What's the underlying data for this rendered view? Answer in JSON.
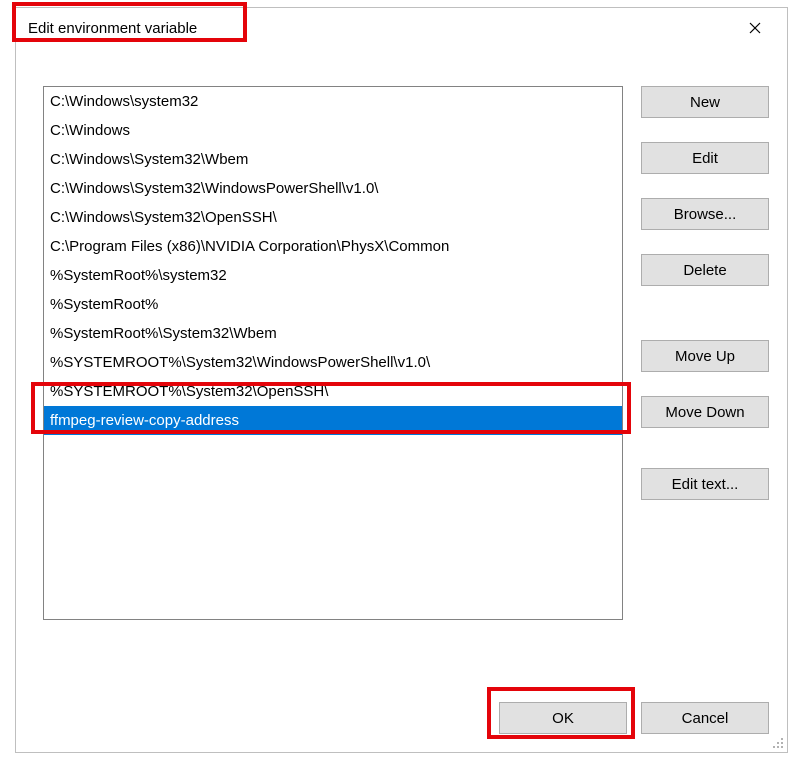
{
  "dialog": {
    "title": "Edit environment variable"
  },
  "list": {
    "items": [
      {
        "text": "C:\\Windows\\system32",
        "selected": false
      },
      {
        "text": "C:\\Windows",
        "selected": false
      },
      {
        "text": "C:\\Windows\\System32\\Wbem",
        "selected": false
      },
      {
        "text": "C:\\Windows\\System32\\WindowsPowerShell\\v1.0\\",
        "selected": false
      },
      {
        "text": "C:\\Windows\\System32\\OpenSSH\\",
        "selected": false
      },
      {
        "text": "C:\\Program Files (x86)\\NVIDIA Corporation\\PhysX\\Common",
        "selected": false
      },
      {
        "text": "%SystemRoot%\\system32",
        "selected": false
      },
      {
        "text": "%SystemRoot%",
        "selected": false
      },
      {
        "text": "%SystemRoot%\\System32\\Wbem",
        "selected": false
      },
      {
        "text": "%SYSTEMROOT%\\System32\\WindowsPowerShell\\v1.0\\",
        "selected": false
      },
      {
        "text": "%SYSTEMROOT%\\System32\\OpenSSH\\",
        "selected": false
      },
      {
        "text": "ffmpeg-review-copy-address",
        "selected": true
      }
    ]
  },
  "buttons": {
    "new": "New",
    "edit": "Edit",
    "browse": "Browse...",
    "delete": "Delete",
    "moveup": "Move Up",
    "movedown": "Move Down",
    "edittext": "Edit text...",
    "ok": "OK",
    "cancel": "Cancel"
  }
}
